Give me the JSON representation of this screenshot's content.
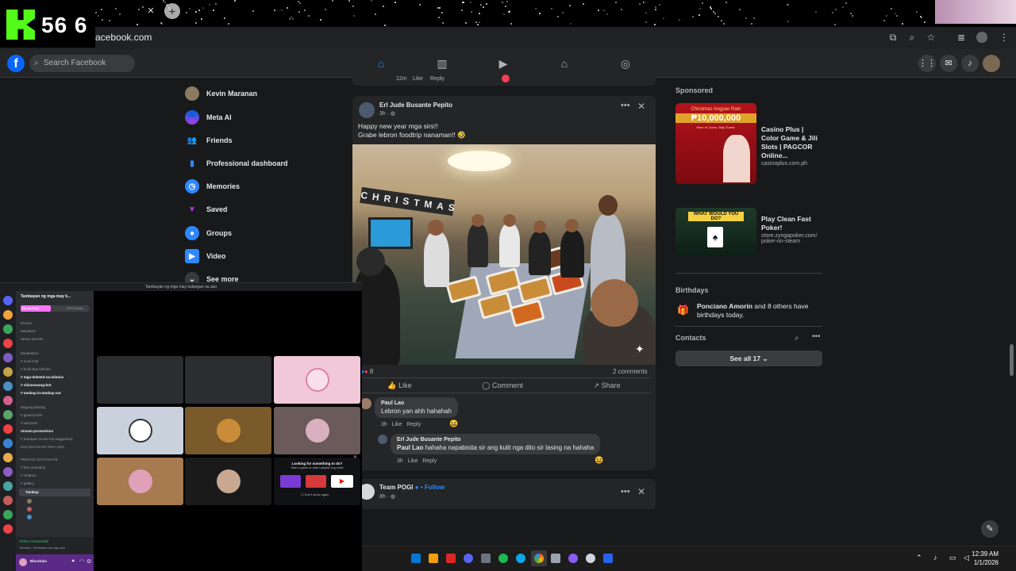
{
  "overlay": {
    "kick_count": "56 6"
  },
  "browser": {
    "url": "acebook.com",
    "icons": [
      "cast-icon",
      "zoom-icon",
      "star-icon",
      "media-icon",
      "profile-icon",
      "menu-icon"
    ]
  },
  "fb_header": {
    "search_placeholder": "Search Facebook"
  },
  "left_nav": {
    "items": [
      {
        "label": "Kevin Maranan",
        "icon": "avatar-icon"
      },
      {
        "label": "Meta AI",
        "icon": "meta-ai-icon"
      },
      {
        "label": "Friends",
        "icon": "friends-icon"
      },
      {
        "label": "Professional dashboard",
        "icon": "dashboard-icon"
      },
      {
        "label": "Memories",
        "icon": "memories-icon"
      },
      {
        "label": "Saved",
        "icon": "saved-icon"
      },
      {
        "label": "Groups",
        "icon": "groups-icon"
      },
      {
        "label": "Video",
        "icon": "video-icon"
      },
      {
        "label": "See more",
        "icon": "chevron-down-icon"
      }
    ]
  },
  "feed": {
    "prev_post": {
      "time": "12m",
      "like": "Like",
      "reply": "Reply"
    },
    "post": {
      "author": "Erl Jude Busante Pepito",
      "time": "3h · ",
      "text_line1": "Happy new year mga sirs!!",
      "text_line2": "Grabe lebron foodtrip nanaman!! 🤣",
      "photo_text": "CHRISTMAS",
      "reaction_count": "8",
      "comments_count": "2 comments",
      "actions": {
        "like": "Like",
        "comment": "Comment",
        "share": "Share"
      },
      "comments": [
        {
          "name": "Paul Lao",
          "text": "Lebron yan ahh hahahah",
          "time": "3h",
          "like": "Like",
          "reply": "Reply"
        },
        {
          "name": "Erl Jude Busante Pepito",
          "mention": "Paul Lao",
          "text": " hahaha napabisita sir ang kulit nga dito sir lasing na hahaha",
          "time": "3h",
          "like": "Like",
          "reply": "Reply"
        }
      ]
    },
    "next_post": {
      "author": "Team POGI",
      "follow": "• Follow",
      "time": "8h · "
    }
  },
  "right_col": {
    "sponsored_label": "Sponsored",
    "ads": [
      {
        "title": "Casino Plus | Color Game & Jili Slots | PAGCOR Online...",
        "domain": "casinoplus.com.ph",
        "banner_title": "Christmas Angpao Rain",
        "banner_amount": "₱10,000,000",
        "banner_sub": "More to Come, Stay Tuned."
      },
      {
        "title": "Play Clean Fast Poker!",
        "domain": "store.zyngapoker.com/ poker-on-steam",
        "banner_title": "WHAT WOULD YOU DO?"
      }
    ],
    "birthdays_label": "Birthdays",
    "birthday_name": "Ponciano Amorin",
    "birthday_text": " and 8 others have birthdays today.",
    "contacts_label": "Contacts",
    "see_all": "See all 17"
  },
  "discord": {
    "window_title": "Tambayan ng mga may kulungan na aso",
    "server_name": "Tambayan ng mga may k...",
    "boost_label": "Boost Goal",
    "boost_count": "9/20 Boosts",
    "channels": [
      {
        "label": "Events",
        "bold": false
      },
      {
        "label": "Members",
        "bold": false
      },
      {
        "label": "Server Boosts",
        "bold": false
      },
      {
        "label": "Moderation",
        "bold": false
      },
      {
        "label": "# mod-chat",
        "bold": false
      },
      {
        "label": "# hello-bye-kitchen",
        "bold": false
      },
      {
        "label": "# mga-deleted-na-talamia",
        "bold": true
      },
      {
        "label": "# chismosang-bot",
        "bold": true
      },
      {
        "label": "# tambay-in-tambay-out",
        "bold": true
      },
      {
        "label": "Bagong tambay",
        "bold": false
      },
      {
        "label": "# general info",
        "bold": false
      },
      {
        "label": "# welcome",
        "bold": false
      },
      {
        "label": "stream-promotions",
        "bold": true
      },
      {
        "label": "# nandyan-movie-trip-suggestion",
        "bold": false
      },
      {
        "label": "KULUNGAN NG MGA ASO",
        "bold": false
      },
      {
        "label": "PRIVATE CHATCHATS",
        "bold": false
      },
      {
        "label": "# bot-command",
        "bold": false
      },
      {
        "label": "# chatbox",
        "bold": false
      },
      {
        "label": "# gallery",
        "bold": false
      },
      {
        "label": "Tambay",
        "bold": true
      }
    ],
    "voice_status": "Video Connected",
    "voice_sub": "Tambay / Tambayan-ng-mga-aso",
    "user": "Bloodrain",
    "activity_title": "Looking for something to do?",
    "activity_sub": "Start a game or video playlist ang invite",
    "dont_show": "Don't show again"
  },
  "taskbar": {
    "time": "12:39 AM",
    "date": "1/1/2026"
  }
}
